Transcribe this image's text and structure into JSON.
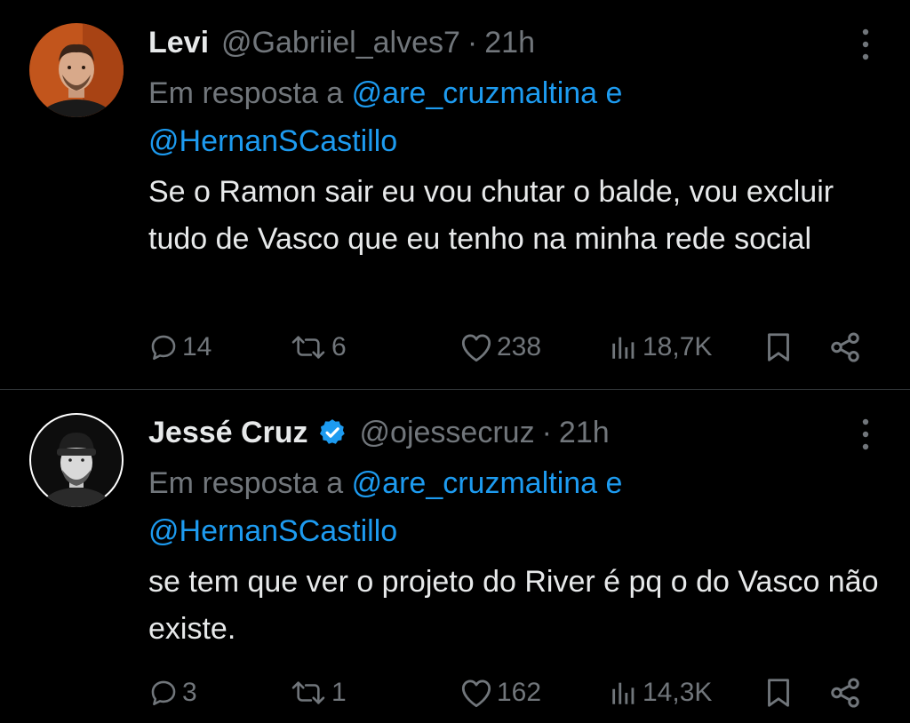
{
  "tweets": [
    {
      "name": "Levi",
      "verified": false,
      "handle": "@Gabriiel_alves7",
      "separator": "·",
      "time": "21h",
      "reply_prefix": "Em resposta a",
      "reply_mention_1": "@are_cruzmaltina",
      "reply_conjunction": "e",
      "reply_mention_2": "@HernanSCastillo",
      "text": "Se o Ramon sair eu vou chutar o balde, vou excluir tudo de Vasco que eu tenho na minha rede social",
      "replies": "14",
      "retweets": "6",
      "likes": "238",
      "views": "18,7K",
      "icons": {
        "more": "more-dots-icon",
        "reply": "reply-bubble-icon",
        "retweet": "retweet-icon",
        "like": "heart-icon",
        "views": "views-bars-icon",
        "bookmark": "bookmark-icon",
        "share": "share-icon"
      }
    },
    {
      "name": "Jessé Cruz",
      "verified": true,
      "handle": "@ojessecruz",
      "separator": "·",
      "time": "21h",
      "reply_prefix": "Em resposta a",
      "reply_mention_1": "@are_cruzmaltina",
      "reply_conjunction": "e",
      "reply_mention_2": "@HernanSCastillo",
      "text": "se tem que ver o projeto do River é pq o do Vasco não existe.",
      "replies": "3",
      "retweets": "1",
      "likes": "162",
      "views": "14,3K",
      "icons": {
        "more": "more-dots-icon",
        "verified": "verified-badge-icon",
        "reply": "reply-bubble-icon",
        "retweet": "retweet-icon",
        "like": "heart-icon",
        "views": "views-bars-icon",
        "bookmark": "bookmark-icon",
        "share": "share-icon"
      }
    }
  ],
  "colors": {
    "background": "#000000",
    "primary_text": "#e7e9ea",
    "secondary_text": "#71767b",
    "link": "#1d9bf0",
    "divider": "#2f3336",
    "verified_badge": "#1d9bf0"
  }
}
